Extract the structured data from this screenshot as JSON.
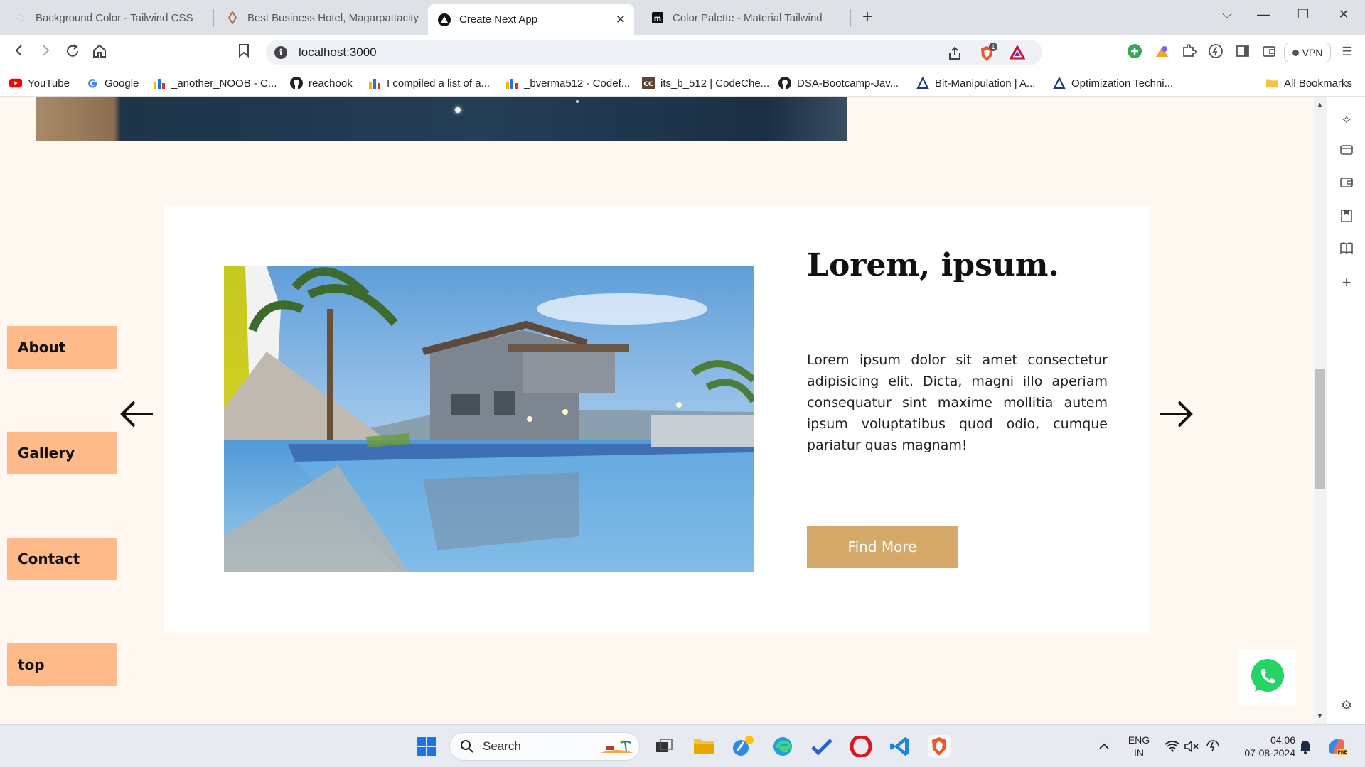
{
  "browser": {
    "tabs": [
      {
        "title": "Background Color - Tailwind CSS",
        "active": false
      },
      {
        "title": "Best Business Hotel, Magarpattacity",
        "active": false
      },
      {
        "title": "Create Next App",
        "active": true
      },
      {
        "title": "Color Palette - Material Tailwind",
        "active": false
      }
    ],
    "url": "localhost:3000",
    "vpn_label": "VPN",
    "brave_badge": "1",
    "bookmarks": [
      {
        "label": "YouTube",
        "icon": "youtube-icon"
      },
      {
        "label": "Google",
        "icon": "google-icon"
      },
      {
        "label": "_another_NOOB - C...",
        "icon": "bars-icon"
      },
      {
        "label": "reachook",
        "icon": "github-icon"
      },
      {
        "label": "I compiled a list of a...",
        "icon": "bars-icon"
      },
      {
        "label": "_bverma512 - Codef...",
        "icon": "bars-icon"
      },
      {
        "label": "its_b_512 | CodeChe...",
        "icon": "codechef-icon"
      },
      {
        "label": "DSA-Bootcamp-Jav...",
        "icon": "github-icon"
      },
      {
        "label": "Bit-Manipulation | A...",
        "icon": "algo-icon"
      },
      {
        "label": "Optimization Techni...",
        "icon": "algo-icon"
      }
    ],
    "all_bookmarks": "All Bookmarks"
  },
  "page": {
    "card": {
      "title": "Lorem, ipsum.",
      "body": "Lorem ipsum dolor sit amet consectetur adipisicing elit. Dicta, magni illo aperiam consequatur sint maxime mollitia autem ipsum voluptatibus quod odio, cumque pariatur quas magnam!",
      "button": "Find More"
    },
    "side_nav": [
      {
        "label": "About"
      },
      {
        "label": "Gallery"
      },
      {
        "label": "Contact"
      },
      {
        "label": "top"
      }
    ],
    "colors": {
      "background": "#fff7f0",
      "side_button": "#ffba8a",
      "find_more": "#d4a96a",
      "card": "#ffffff"
    }
  },
  "taskbar": {
    "search_placeholder": "Search",
    "language": "ENG",
    "region": "IN",
    "time": "04:06",
    "date": "07-08-2024"
  }
}
